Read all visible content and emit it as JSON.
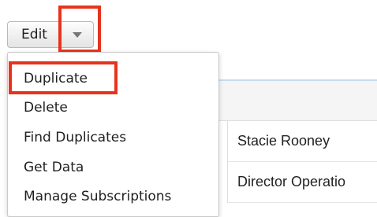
{
  "actions": {
    "edit_label": "Edit",
    "caret_icon": "chevron-down-icon"
  },
  "menu": {
    "items": [
      {
        "label": "Duplicate",
        "highlighted": true
      },
      {
        "label": "Delete"
      },
      {
        "label": "Find Duplicates"
      },
      {
        "label": "Get Data"
      },
      {
        "label": "Manage Subscriptions"
      }
    ]
  },
  "record": {
    "name": "Stacie Rooney",
    "title": "Director Operatio"
  },
  "colors": {
    "highlight": "#e8331c",
    "panel_line": "#c7dcef"
  }
}
